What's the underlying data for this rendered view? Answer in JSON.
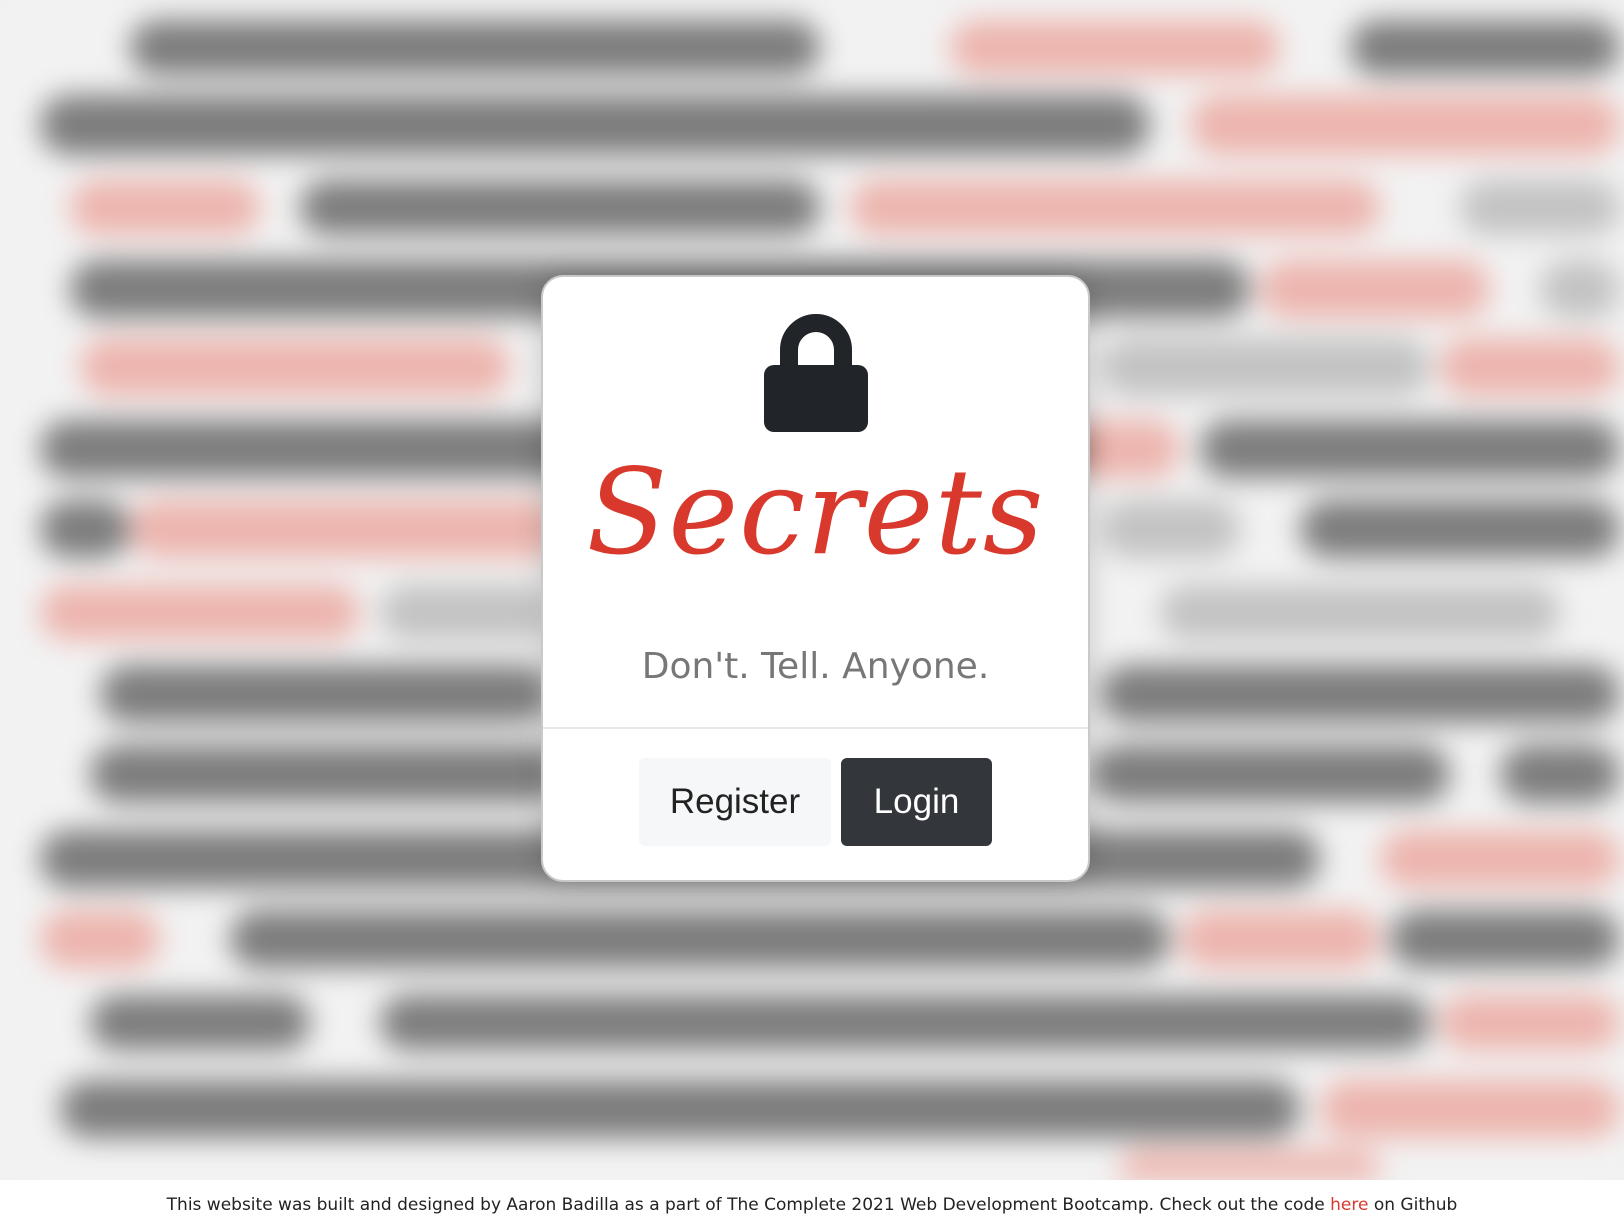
{
  "card": {
    "icon": "lock-icon",
    "title": "Secrets",
    "subtitle": "Don't. Tell. Anyone.",
    "register_label": "Register",
    "login_label": "Login"
  },
  "footer": {
    "text_before": "This website was built and designed by Aaron Badilla as a part of The Complete 2021 Web Development Bootcamp. Check out the code ",
    "link_label": "here",
    "text_after": " on Github"
  },
  "colors": {
    "accent": "#d9392c",
    "login_button": "#33373b",
    "register_button": "#f6f7f8",
    "subtitle": "#777777"
  }
}
